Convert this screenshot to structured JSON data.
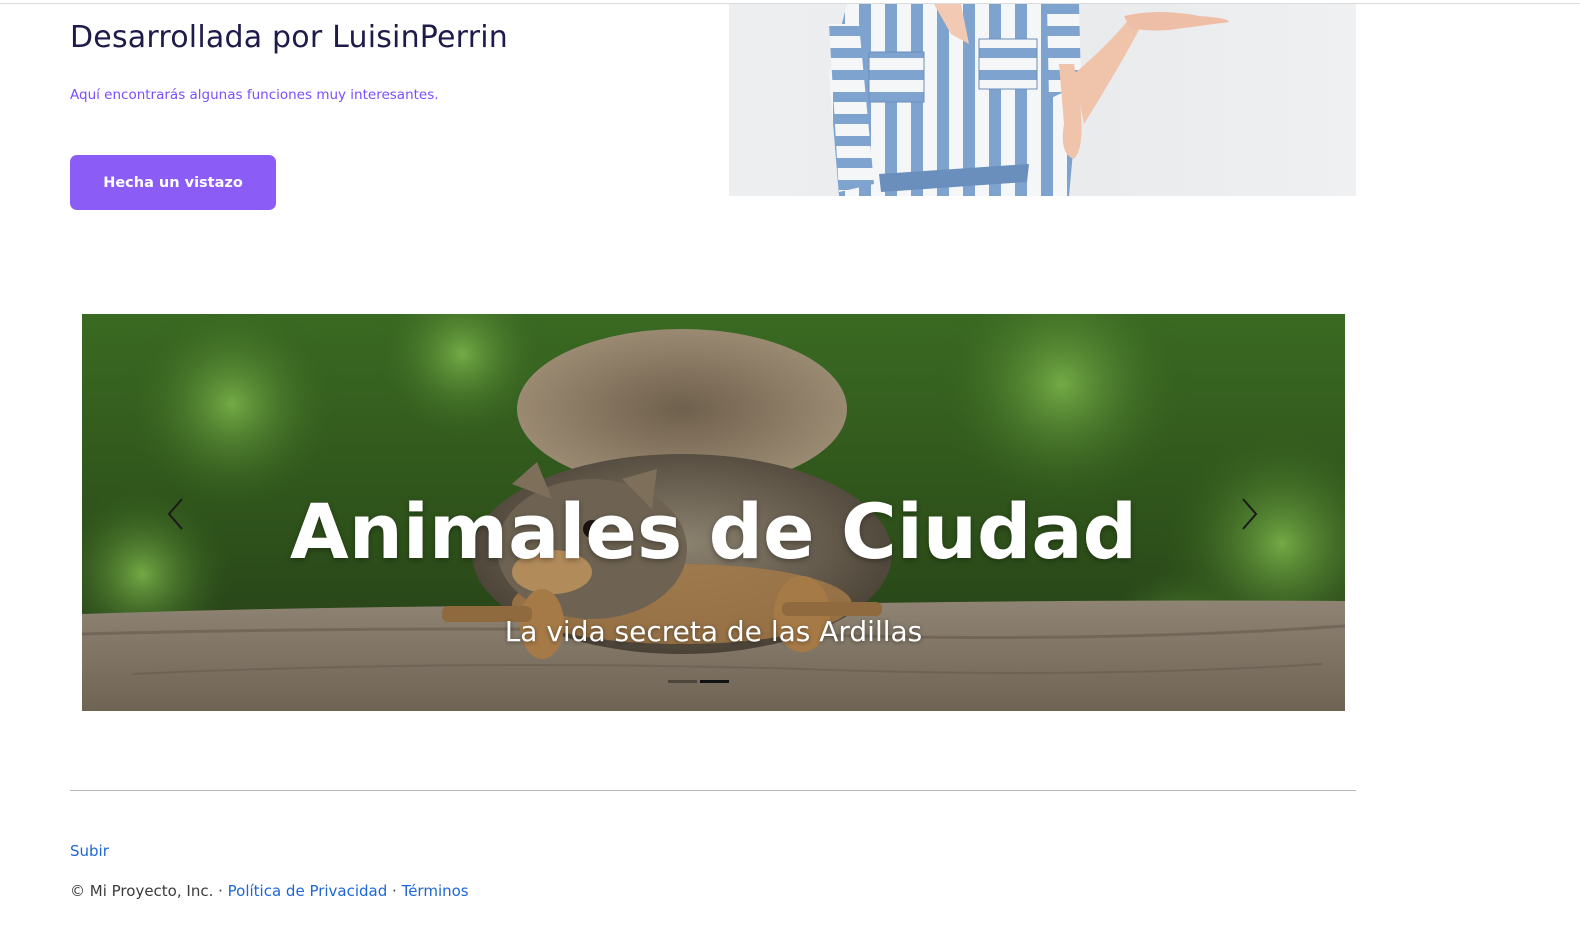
{
  "hero": {
    "title": "Desarrollada por LuisinPerrin",
    "subtitle": "Aquí encontrarás algunas funciones muy interesantes.",
    "button_label": "Hecha un vistazo"
  },
  "carousel": {
    "slide_title": "Animales de Ciudad",
    "slide_subtitle": "La vida secreta de las Ardillas",
    "indicators": [
      "slide-1",
      "slide-2"
    ],
    "active_index": 1
  },
  "footer": {
    "back_to_top": "Subir",
    "copyright": "© Mi Proyecto, Inc. · ",
    "privacy_link": "Política de Privacidad",
    "separator": " · ",
    "terms_link": "Términos"
  },
  "colors": {
    "accent": "#8b5cf6",
    "subtitle": "#7c4dff",
    "link": "#1e66d6"
  }
}
